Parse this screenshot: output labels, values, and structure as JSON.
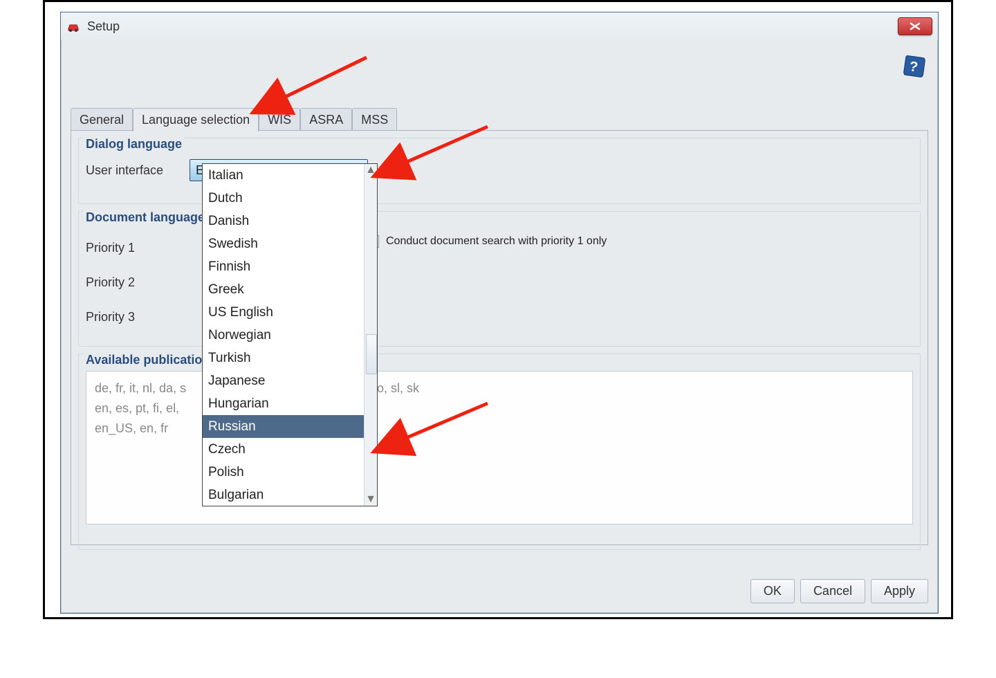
{
  "window": {
    "title": "Setup"
  },
  "tabs": {
    "general": "General",
    "language_selection": "Language selection",
    "wis": "WIS",
    "asra": "ASRA",
    "mss": "MSS"
  },
  "dialog_language": {
    "legend": "Dialog language",
    "user_interface_label": "User interface",
    "user_interface_value": "English"
  },
  "document_language": {
    "legend": "Document language",
    "priority1_label": "Priority 1",
    "priority2_label": "Priority 2",
    "priority3_label": "Priority 3",
    "checkbox_label": "Conduct document search with priority 1 only"
  },
  "available_publications": {
    "legend": "Available publications",
    "line1": "de, fr, it, nl, da, s",
    "line2": "en, es, pt, fi, el,",
    "line3": "en_US, en, fr",
    "line1b": "ro, sl, sk"
  },
  "dropdown": {
    "items": [
      "Italian",
      "Dutch",
      "Danish",
      "Swedish",
      "Finnish",
      "Greek",
      "US English",
      "Norwegian",
      "Turkish",
      "Japanese",
      "Hungarian",
      "Russian",
      "Czech",
      "Polish",
      "Bulgarian"
    ],
    "selected_index": 11
  },
  "buttons": {
    "ok": "OK",
    "cancel": "Cancel",
    "apply": "Apply"
  }
}
